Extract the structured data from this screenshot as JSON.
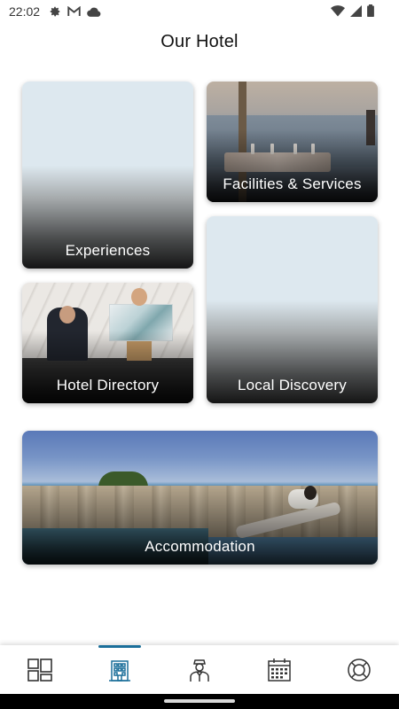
{
  "status_bar": {
    "time": "22:02",
    "left_icons": [
      "gear-icon",
      "gmail-icon",
      "cloud-icon"
    ],
    "right_icons": [
      "wifi-icon",
      "signal-icon",
      "battery-icon"
    ]
  },
  "header": {
    "title": "Our Hotel"
  },
  "tiles": [
    {
      "label": "Experiences"
    },
    {
      "label": "Facilities & Services"
    },
    {
      "label": "Hotel Directory"
    },
    {
      "label": "Local Discovery"
    },
    {
      "label": "Accommodation"
    }
  ],
  "bottom_nav": {
    "accent_color": "#1b6f9a",
    "active_index": 1,
    "items": [
      {
        "icon": "dashboard-grid-icon"
      },
      {
        "icon": "hotel-building-icon"
      },
      {
        "icon": "concierge-icon"
      },
      {
        "icon": "calendar-icon"
      },
      {
        "icon": "lifebuoy-icon"
      }
    ]
  }
}
